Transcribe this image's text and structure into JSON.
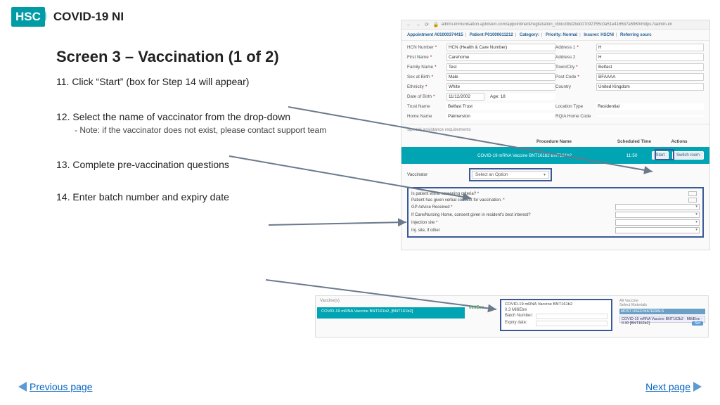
{
  "header": {
    "logo": "HSC",
    "brand": "COVID-19 NI"
  },
  "title": "Screen 3 – Vaccination (1 of 2)",
  "steps": {
    "s11": "11. Click “Start” (box for Step 14 will appear)",
    "s12": "12. Select the name of vaccinator from the drop-down",
    "s12_sub": "- Note: if the vaccinator does not exist, please contact support team",
    "s13": "13. Complete pre-vaccination questions",
    "s14": "14. Enter batch number and expiry date"
  },
  "footer": {
    "prev": "Previous page",
    "next": "Next page"
  },
  "shot1": {
    "url": "admin-immunisation.aptvision.com/appointment/registration_clinic/dbd2bdd17c92755c0a51e4165b7a5960#https://admin-im",
    "crumb": {
      "appt": "Appointment A01000374415",
      "patient": "Patient P01000611212",
      "category": "Category:",
      "priority": "Priority: Normal",
      "insurer": "Insurer: HSCNI",
      "referring": "Referring sourc"
    },
    "left": {
      "hcn_l": "HCN Number",
      "hcn_v": "HCN (Health & Care Number)",
      "first_l": "First Name",
      "first_v": "Carehome",
      "family_l": "Family Name",
      "family_v": "Test",
      "sex_l": "Sex at Birth",
      "sex_v": "Male",
      "eth_l": "Ethnicity",
      "eth_v": "White",
      "dob_l": "Date of Birth",
      "dob_v": "11/12/2002",
      "age": "Age: 18",
      "trust_l": "Trust Name",
      "trust_v": "Belfast Trust",
      "home_l": "Home Name",
      "home_v": "Palmerston"
    },
    "right": {
      "addr1_l": "Address 1",
      "addr1_v": "H",
      "addr2_l": "Address 2",
      "addr2_v": "H",
      "town_l": "Town/City",
      "town_v": "Belfast",
      "post_l": "Post Code",
      "post_v": "BFAAAA",
      "country_l": "Country",
      "country_v": "United Kingdom",
      "loc_l": "Location Type",
      "loc_v": "Residential",
      "rqia_l": "RQIA Home Code",
      "rqia_v": ""
    },
    "special": "Special assistance requirements",
    "thead": {
      "procedure": "Procedure Name",
      "time": "Scheduled Time",
      "actions": "Actions"
    },
    "teal": {
      "name": "COVID-19 mRNA Vaccine BNT161b2 BNT161b2",
      "time": "11:50",
      "start": "Start",
      "switch": "Switch room"
    },
    "vacc_l": "Vaccinator",
    "vacc_ph": "Select an Option",
    "q": {
      "q1": "Is patient within screening criteria? *",
      "q2": "Patient has given verbal consent for vaccination. *",
      "q3": "GP Advice Received *",
      "q4": "If Care/Nursing Home, consent given in resident's best interest?",
      "q5": "Injection site *",
      "q6": "Inj. site, if other"
    }
  },
  "shot2": {
    "tag": "Vaccine(s)",
    "teal": "COVID-19 mRNA Vaccine BNT161b2, [BNT161b2]",
    "measure": "MilliEtre",
    "box": {
      "title": "COVID-19 mRNA Vaccine BNT161b2",
      "dose_l": "0.3",
      "dose_u": "MilliEtre",
      "batch_l": "Batch Number:",
      "exp_l": "Expiry date:"
    },
    "right": {
      "t1": "All Vaccine",
      "t2": "Select Materials",
      "box": "COVID-19 mRNA Vaccine BNT162b2 - MilliEtre - 0.30 [BNT162b2]",
      "heading": "MOST USED MATERIALS",
      "set": "Set"
    }
  }
}
